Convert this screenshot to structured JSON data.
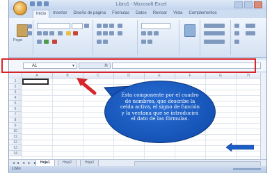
{
  "window": {
    "title": "Libro1 - Microsoft Excel"
  },
  "ribbon": {
    "tabs": [
      "Inicio",
      "Insertar",
      "Diseño de página",
      "Fórmulas",
      "Datos",
      "Revisar",
      "Vista",
      "Complementos"
    ],
    "active_tab": "Inicio",
    "paste_label": "Pegar"
  },
  "formula_bar": {
    "name_box_value": "A1",
    "fx_label": "fx",
    "formula_value": ""
  },
  "grid": {
    "columns": [
      "A",
      "B",
      "C",
      "D",
      "E",
      "F",
      "G",
      "H"
    ],
    "rows": [
      "1",
      "2",
      "3",
      "4",
      "5",
      "6",
      "7",
      "8",
      "9",
      "10",
      "11",
      "12",
      "13",
      "14"
    ]
  },
  "sheets": {
    "tabs": [
      "Hoja1",
      "Hoja2",
      "Hoja3"
    ],
    "active": "Hoja1"
  },
  "status_bar": {
    "text": "Listo"
  },
  "callout": {
    "text": "Esta componente por el cuadro de nombres, que describe la celda activa, el signo de función y la ventana que se introducirá el dato de las fórmulas."
  },
  "colors": {
    "highlight": "#d8252b",
    "arrow": "#d8252b",
    "callout": "#1553b6"
  },
  "icons": {
    "office_button": "office-logo-icon",
    "red_arrow": "red-arrow-icon",
    "next_button": "next-arrow-icon"
  }
}
